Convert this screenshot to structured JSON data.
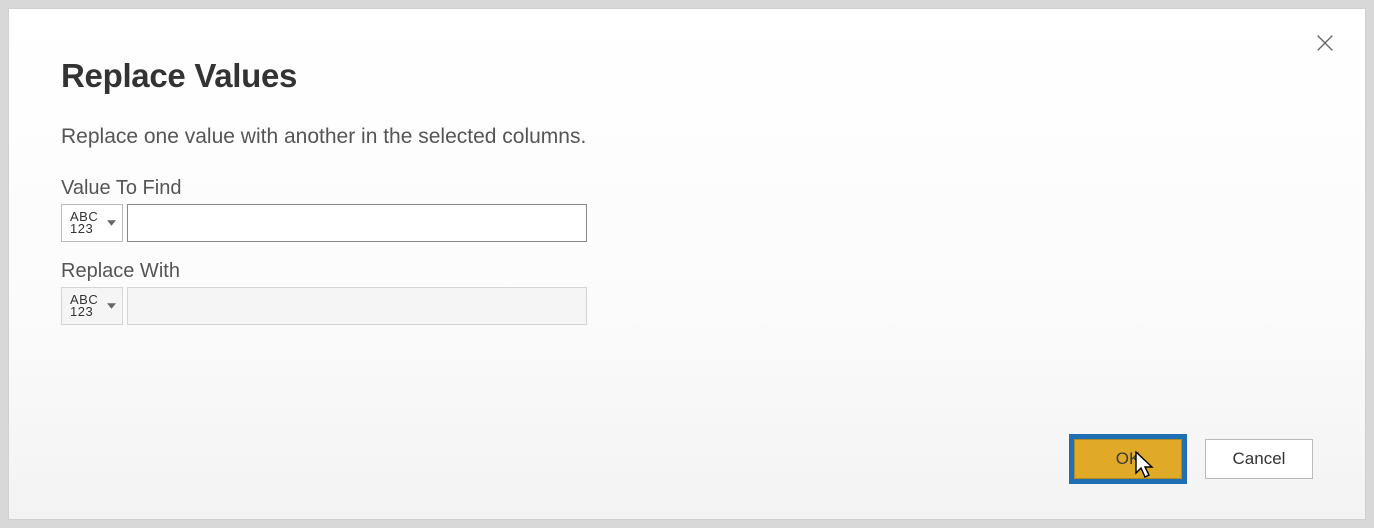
{
  "dialog": {
    "title": "Replace Values",
    "subtitle": "Replace one value with another in the selected columns.",
    "type_indicator_top": "ABC",
    "type_indicator_bottom": "123",
    "fields": {
      "find": {
        "label": "Value To Find",
        "value": ""
      },
      "replace": {
        "label": "Replace With",
        "value": ""
      }
    },
    "buttons": {
      "ok": "OK",
      "cancel": "Cancel"
    }
  }
}
